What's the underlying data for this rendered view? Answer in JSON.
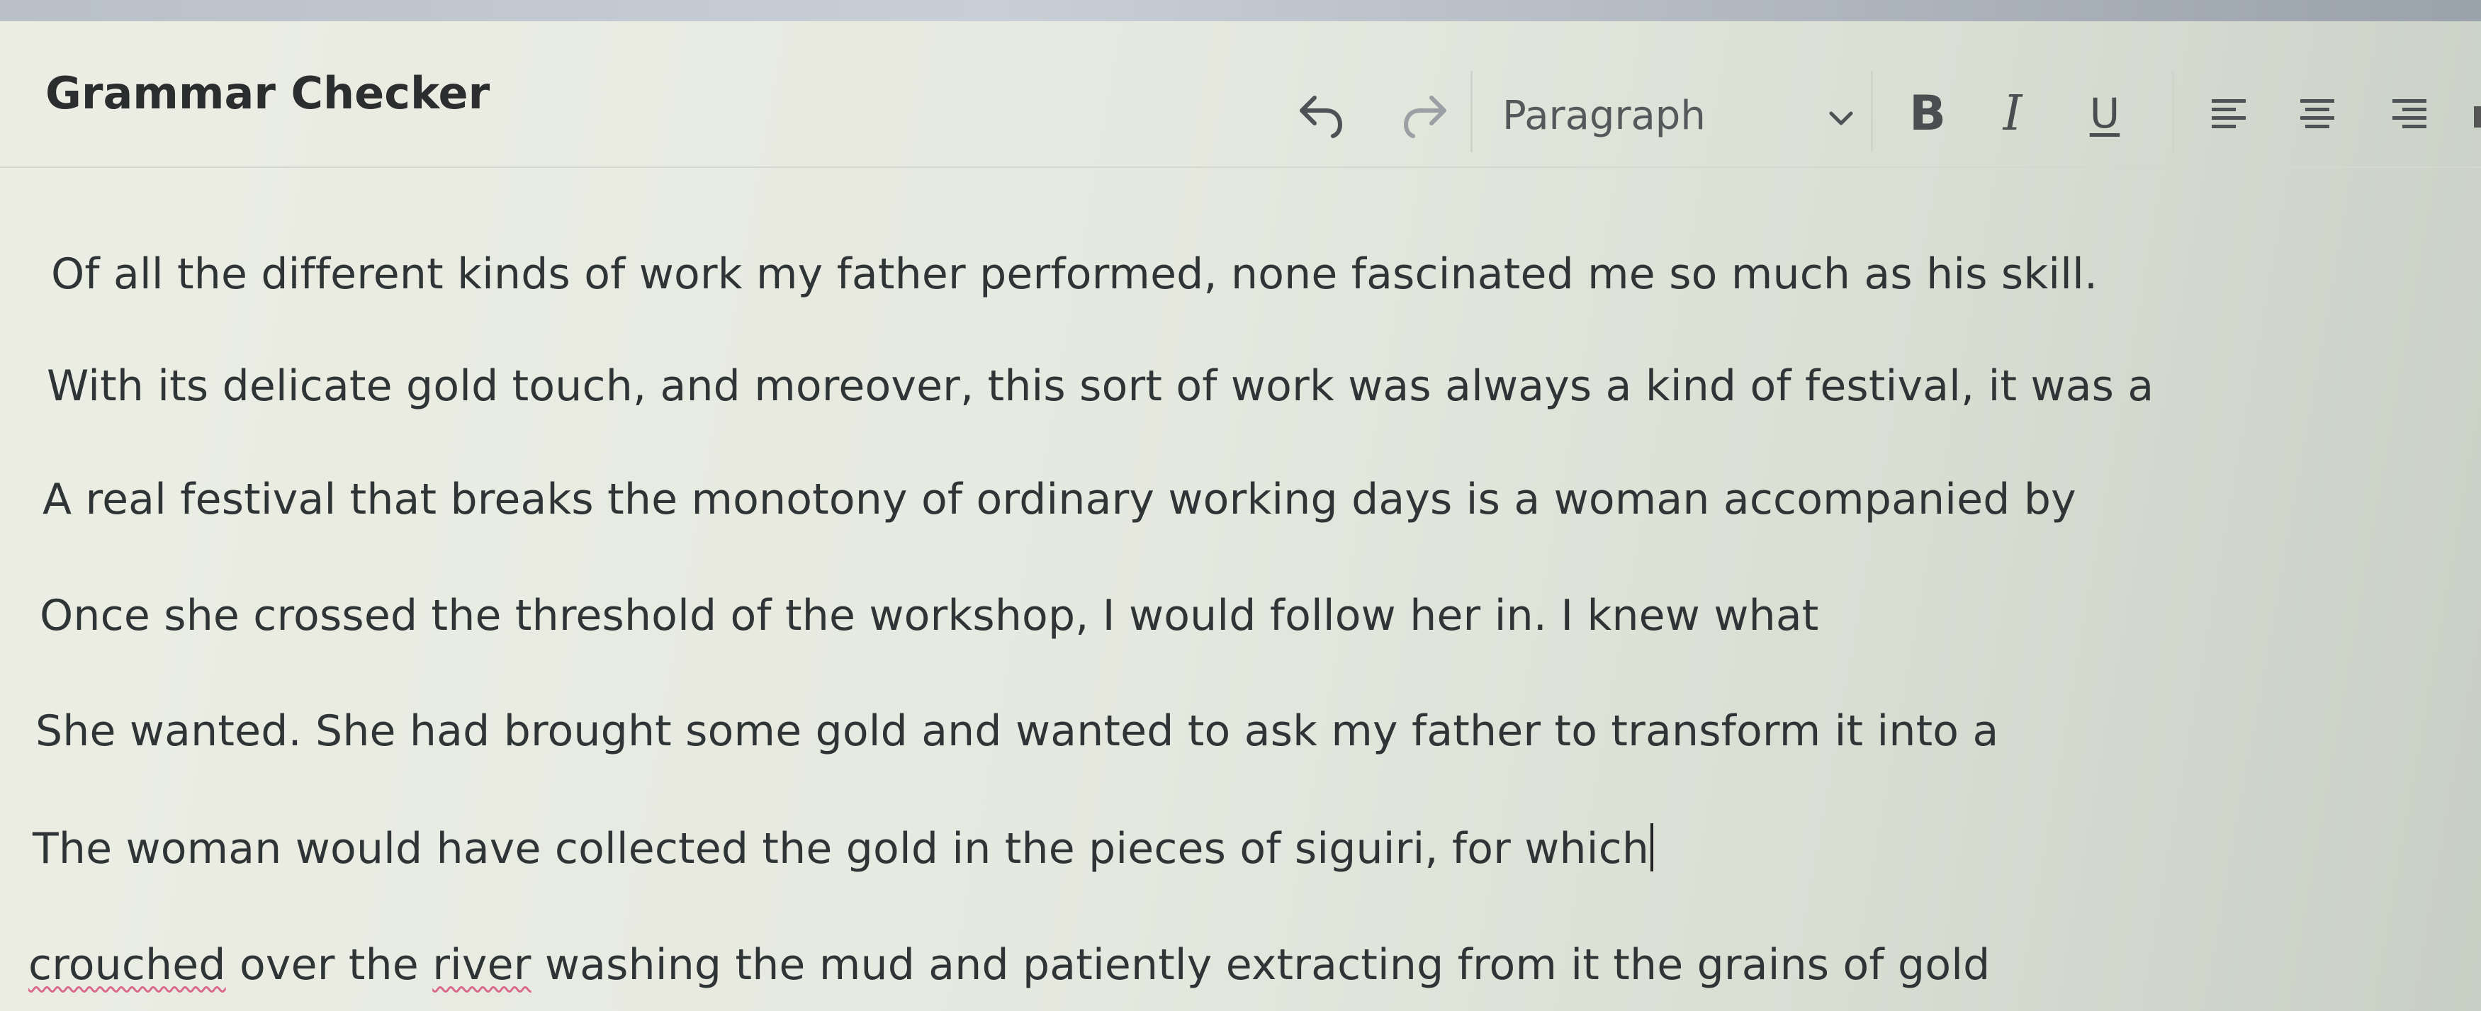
{
  "app": {
    "title": "Grammar Checker"
  },
  "toolbar": {
    "undo_icon": "undo-icon",
    "redo_icon": "redo-icon",
    "block_format": {
      "selected": "Paragraph",
      "icon": "chevron-down-icon"
    },
    "bold_label": "B",
    "italic_label": "I",
    "underline_label": "U",
    "align_left_icon": "align-left-icon",
    "align_center_icon": "align-center-icon",
    "align_right_icon": "align-right-icon"
  },
  "editor": {
    "lines": [
      {
        "text": "Of all the different kinds of work my father performed, none fascinated me so much as his skill."
      },
      {
        "text": "With its delicate gold touch, and moreover, this sort of work was always a kind of festival, it was a"
      },
      {
        "text": "A real festival that breaks the monotony of ordinary working days is a woman accompanied by"
      },
      {
        "text": "Once she crossed the threshold of the workshop, I would follow her in. I knew what"
      },
      {
        "text": "She wanted. She had brought some gold and wanted to ask my father to transform it into a"
      },
      {
        "text": "The woman would have collected the gold in the pieces of siguiri, for which"
      },
      {
        "text_before": "",
        "misspelled_1": "crouched",
        "text_middle_1": " over the ",
        "misspelled_2": "river",
        "text_after": " washing the mud and patiently extracting from it the grains of gold"
      }
    ]
  },
  "colors": {
    "text": "#2f3436",
    "title": "#2b2d2e",
    "spell_underline": "#d86a8a",
    "background": "#e6e9df"
  }
}
